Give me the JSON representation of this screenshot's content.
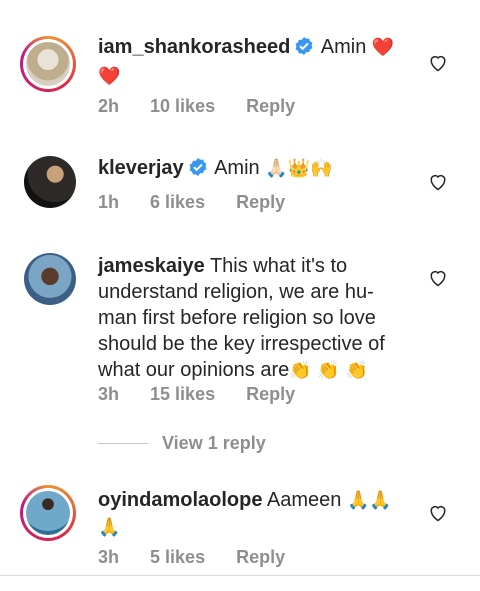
{
  "comments": [
    {
      "username": "iam_shankorasheed",
      "verified": true,
      "text": "Amin",
      "emoji": "❤️ ❤️",
      "time": "2h",
      "likes": "10 likes",
      "reply": "Reply"
    },
    {
      "username": "kleverjay",
      "verified": true,
      "text": "Amin",
      "emoji": "🙏🏻👑🙌",
      "time": "1h",
      "likes": "6 likes",
      "reply": "Reply"
    },
    {
      "username": "jameskaiye",
      "verified": false,
      "text": "This what it's to understand religion, we are hu-man first before religion so love should be the key irrespective of what our opinions are",
      "emoji": "👏 👏 👏",
      "time": "3h",
      "likes": "15 likes",
      "reply": "Reply"
    },
    {
      "username": "oyindamolaolope",
      "verified": false,
      "text": "Aameen",
      "emoji": "🙏🙏 🙏",
      "time": "3h",
      "likes": "5 likes",
      "reply": "Reply"
    }
  ],
  "view_replies": "View 1 reply",
  "colors": {
    "verified_blue": "#3897f0",
    "meta_gray": "#8e8e8e"
  }
}
